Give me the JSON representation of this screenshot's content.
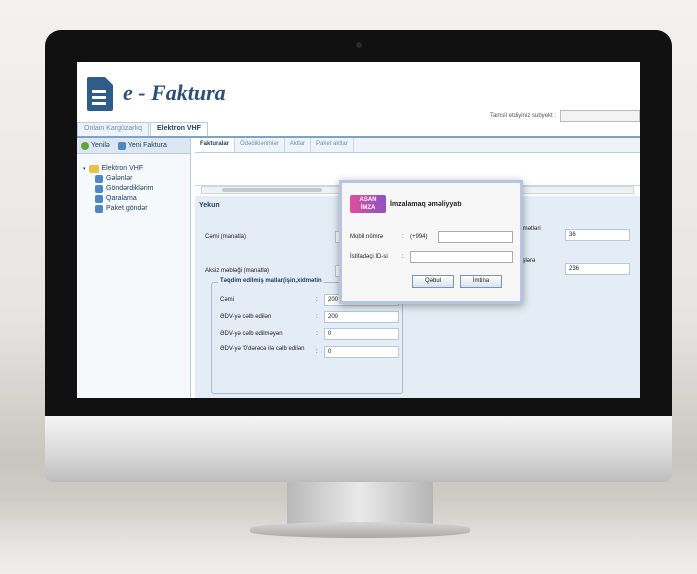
{
  "app": {
    "logo_text": "e - Faktura",
    "subject_label": "Tamsil etdiyiniz subyekt :",
    "subject_value": ""
  },
  "top_tabs": [
    "Onlain Kargüzarlıq",
    "Elektron VHF"
  ],
  "sidebar": {
    "toolbar": [
      "Yenilə",
      "Yeni Faktura"
    ],
    "tree_root": "Elektron VHF",
    "items": [
      "Gələnlər",
      "Göndərdiklərim",
      "Qaralama",
      "Paket göndər"
    ]
  },
  "subtabs": [
    "Fakturalar",
    "Ödədiklərimlər",
    "Aktlar",
    "Paket aktlar"
  ],
  "summary": {
    "heading": "Yekun",
    "row1_label": "Cəmi (manatla)",
    "row2_label": "Aksiz məbləği (manatla)",
    "right1_label": "xidmətləri",
    "right1_value": "36",
    "right2_label": "iş işlərə",
    "right2_value": "236"
  },
  "group": {
    "title": "Təqdim edilmiş mallar(işin,xidmətin",
    "rows": [
      {
        "label": "Cəmi",
        "value": "200"
      },
      {
        "label": "ƏDV-yə cəlb edilən",
        "value": "200"
      },
      {
        "label": "ƏDV-yə cəlb edilməyən",
        "value": "0"
      },
      {
        "label": "ƏDV-yə '0'dərəcə ilə cəlb edilən",
        "value": "0"
      }
    ]
  },
  "dialog": {
    "brand_line1": "ASAN",
    "brand_line2": "İMZA",
    "title": "İmzalamaq əməliyyatı",
    "mobile_label": "Mobil nömrə",
    "mobile_prefix": "(+994)",
    "mobile_value": "",
    "user_label": "İstifadəçi ID-si",
    "user_value": "",
    "accept_label": "Qəbul",
    "cancel_label": "İmtina"
  },
  "colors": {
    "accent": "#2f5d8a",
    "tab_border": "#7fa3c6",
    "panel": "#e4ecf5"
  }
}
